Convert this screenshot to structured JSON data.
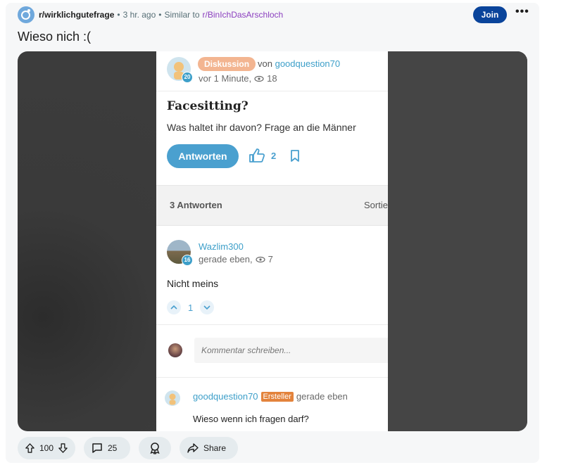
{
  "post": {
    "subreddit": "r/wirklichgutefrage",
    "time": "3 hr. ago",
    "similar_prefix": "Similar to",
    "similar_sub": "r/BinIchDasArschloch",
    "join_label": "Join",
    "more_label": "•••",
    "title": "Wieso nich :("
  },
  "screenshot": {
    "tag": "Diskussion",
    "von_label": "von",
    "author": "goodquestion70",
    "author_badge": "20",
    "time": "vor 1 Minute,",
    "views": "18",
    "question_title": "Facesitting?",
    "question_body": "Was haltet ihr davon? Frage an die Männer",
    "answer_button": "Antworten",
    "likes": "2",
    "answers_count": "3 Antworten",
    "sort_label": "Sortie",
    "answer": {
      "user": "Wazlim300",
      "badge": "16",
      "time": "gerade eben,",
      "views": "7",
      "text": "Nicht meins",
      "votes": "1"
    },
    "comment_placeholder": "Kommentar schreiben...",
    "reply": {
      "user": "goodquestion70",
      "role": "Ersteller",
      "time": "gerade eben",
      "text": "Wieso wenn ich fragen darf?"
    }
  },
  "actions": {
    "score": "100",
    "comments": "25",
    "share": "Share"
  },
  "colors": {
    "join_bg": "#0a449b",
    "link_blue": "#3d9fc9",
    "tag_orange": "#f3b591",
    "ersteller_orange": "#e3833c"
  }
}
